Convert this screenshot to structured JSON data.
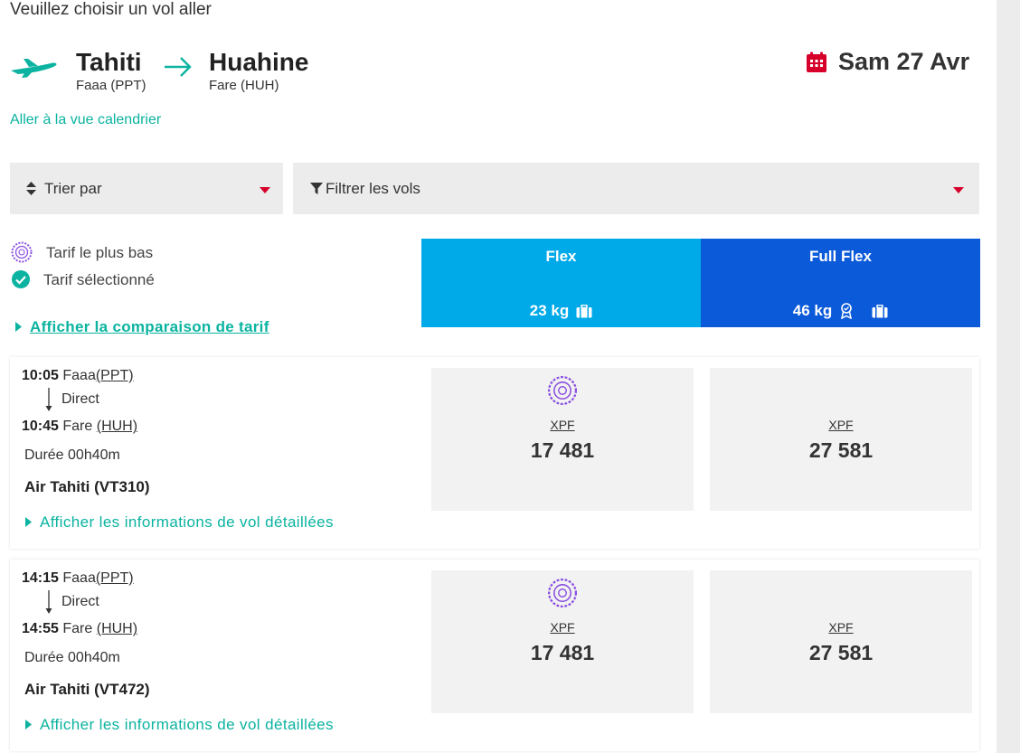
{
  "heading": "Veuillez choisir un vol aller",
  "route": {
    "origin_city": "Tahiti",
    "origin_airport": "Faaa (PPT)",
    "dest_city": "Huahine",
    "dest_airport": "Fare (HUH)",
    "date": "Sam 27 Avr"
  },
  "calendar_link": "Aller à la vue calendrier",
  "sort": {
    "label": "Trier par"
  },
  "filter": {
    "label": "Filtrer les vols"
  },
  "legend": {
    "lowest": "Tarif le plus bas",
    "selected": "Tarif sélectionné"
  },
  "fares": [
    {
      "name": "Flex",
      "baggage": "23 kg",
      "color": "#00a9e8"
    },
    {
      "name": "Full Flex",
      "baggage": "46 kg",
      "color": "#0b5ad9"
    }
  ],
  "compare_link": "Afficher la comparaison de tarif",
  "flights": [
    {
      "dep_time": "10:05",
      "dep_name": "Faaa",
      "dep_code": "(PPT)",
      "stop": "Direct",
      "arr_time": "10:45",
      "arr_name": "Fare",
      "arr_code": "(HUH)",
      "duration": "Durée 00h40m",
      "airline": "Air Tahiti (VT310)",
      "details": "Afficher les informations de vol détaillées",
      "prices": [
        {
          "currency": "XPF",
          "amount": "17 481"
        },
        {
          "currency": "XPF",
          "amount": "27 581"
        }
      ]
    },
    {
      "dep_time": "14:15",
      "dep_name": "Faaa",
      "dep_code": "(PPT)",
      "stop": "Direct",
      "arr_time": "14:55",
      "arr_name": "Fare",
      "arr_code": "(HUH)",
      "duration": "Durée 00h40m",
      "airline": "Air Tahiti (VT472)",
      "details": "Afficher les informations de vol détaillées",
      "prices": [
        {
          "currency": "XPF",
          "amount": "17 481"
        },
        {
          "currency": "XPF",
          "amount": "27 581"
        }
      ]
    }
  ],
  "colors": {
    "teal": "#0bb3a0",
    "red": "#d6002a",
    "flex": "#00a9e8",
    "full_flex": "#0b5ad9",
    "lowest": "#8a4fe0"
  }
}
